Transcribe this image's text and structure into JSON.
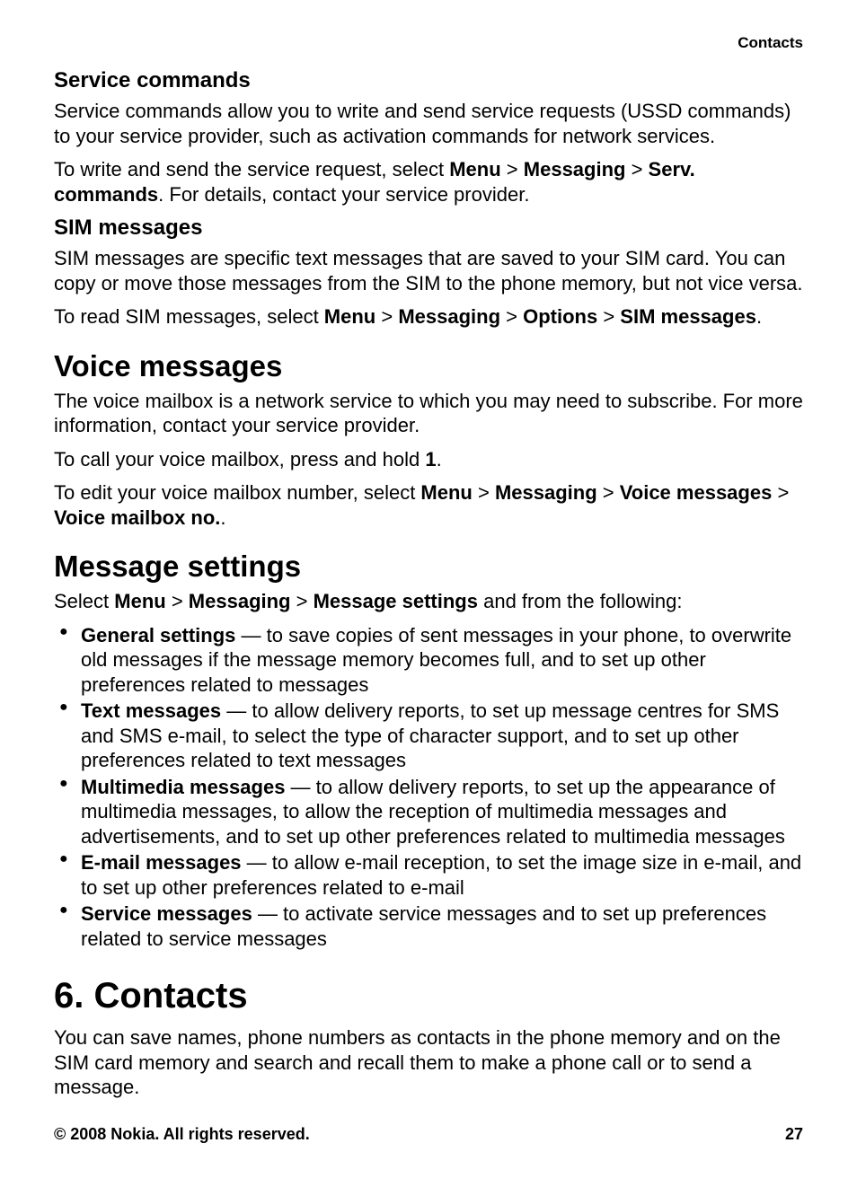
{
  "header": {
    "section_label": "Contacts"
  },
  "service_commands": {
    "heading": "Service commands",
    "p1": "Service commands allow you to write and send service requests (USSD commands) to your service provider, such as activation commands for network services.",
    "p2_pre": "To write and send the service request, select ",
    "p2_menu": "Menu",
    "p2_messaging": "Messaging",
    "p2_serv": "Serv. commands",
    "p2_post": ". For details, contact your service provider."
  },
  "sim_messages": {
    "heading": "SIM messages",
    "p1": "SIM messages are specific text messages that are saved to your SIM card. You can copy or move those messages from the SIM to the phone memory, but not vice versa.",
    "p2_pre": "To read SIM messages, select ",
    "p2_menu": "Menu",
    "p2_messaging": "Messaging",
    "p2_options": "Options",
    "p2_sim": "SIM messages",
    "p2_post": "."
  },
  "voice_messages": {
    "heading": "Voice messages",
    "p1": "The voice mailbox is a network service to which you may need to subscribe. For more information, contact your service provider.",
    "p2_pre": "To call your voice mailbox, press and hold ",
    "p2_key": "1",
    "p2_post": ".",
    "p3_pre": "To edit your voice mailbox number, select ",
    "p3_menu": "Menu",
    "p3_messaging": "Messaging",
    "p3_voice": "Voice messages",
    "p3_mailbox": "Voice mailbox no.",
    "p3_post": "."
  },
  "message_settings": {
    "heading": "Message settings",
    "p1_pre": "Select ",
    "p1_menu": "Menu",
    "p1_messaging": "Messaging",
    "p1_settings": "Message settings",
    "p1_post": " and from the following:",
    "items": [
      {
        "label": "General settings",
        "desc": " — to save copies of sent messages in your phone, to overwrite old messages if the message memory becomes full, and to set up other preferences related to messages"
      },
      {
        "label": "Text messages",
        "desc": " — to allow delivery reports, to set up message centres for SMS and SMS e-mail, to select the type of character support, and to set up other preferences related to text messages"
      },
      {
        "label": "Multimedia messages",
        "desc": " — to allow delivery reports, to set up the appearance of multimedia messages, to allow the reception of multimedia messages and advertisements, and to set up other preferences related to multimedia messages"
      },
      {
        "label": "E-mail messages",
        "desc": " — to allow e-mail reception, to set the image size in e-mail, and to set up other preferences related to e-mail"
      },
      {
        "label": "Service messages",
        "desc": " — to activate service messages and to set up preferences related to service messages"
      }
    ]
  },
  "contacts": {
    "heading": "6.   Contacts",
    "p1": "You can save names, phone numbers as contacts in the phone memory and on the SIM card memory and search and recall them to make a phone call or to send a message."
  },
  "footer": {
    "copyright": "© 2008 Nokia. All rights reserved.",
    "page": "27"
  },
  "sep": " > "
}
